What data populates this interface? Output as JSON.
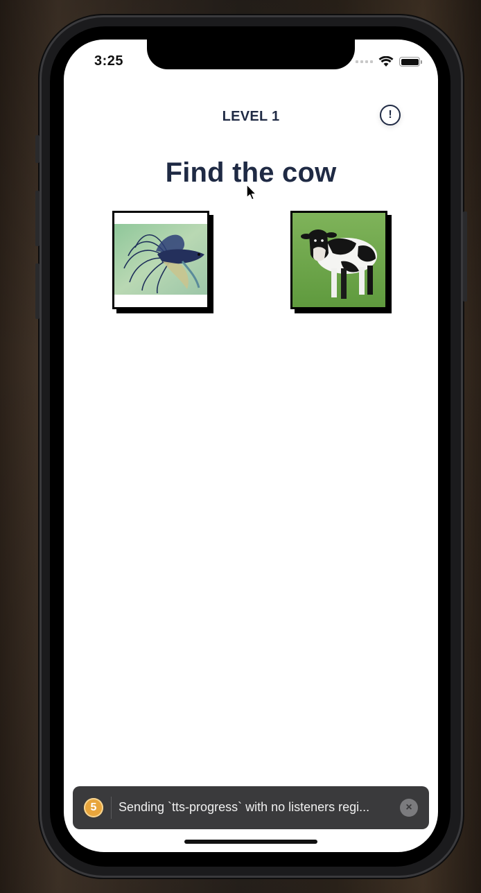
{
  "status_bar": {
    "time": "3:25",
    "icons": [
      "cellular-signal-icon",
      "wifi-icon",
      "battery-icon"
    ]
  },
  "header": {
    "level_label": "LEVEL 1",
    "info_icon": "!"
  },
  "prompt": {
    "title": "Find the cow"
  },
  "choices": [
    {
      "subject": "fish",
      "image": "betta-fish-photo"
    },
    {
      "subject": "cow",
      "image": "holstein-cow-photo"
    }
  ],
  "toast": {
    "count": "5",
    "message": "Sending `tts-progress` with no listeners regi...",
    "close_icon": "×"
  },
  "colors": {
    "title_navy": "#1f2a44",
    "toast_background": "#3a3a3c",
    "toast_badge": "#e8a53c"
  }
}
